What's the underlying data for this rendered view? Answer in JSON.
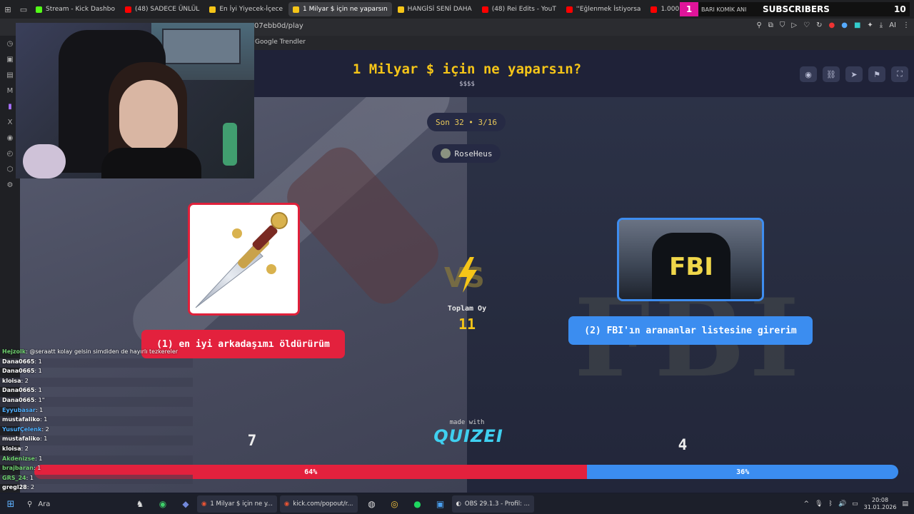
{
  "browser": {
    "tabs": [
      {
        "label": "Stream - Kick Dashbo",
        "color": "#53fc18"
      },
      {
        "label": "(48) SADECE ÜNLÜL",
        "color": "#ff0000"
      },
      {
        "label": "En İyi Yiyecek-İçece",
        "color": "#f5c518"
      },
      {
        "label": "1 Milyar $ için ne yaparsın",
        "color": "#f5c518",
        "active": true
      },
      {
        "label": "HANGİSİ SENİ DAHA",
        "color": "#f5c518"
      },
      {
        "label": "(48) Rei Edits - YouT",
        "color": "#ff0000"
      },
      {
        "label": "''Eğlenmek İstiyorsa",
        "color": "#ff0000"
      },
      {
        "label": "1.000.000TL ÖDÜLL",
        "color": "#ff0000"
      }
    ],
    "url": "07ebb0d/play",
    "bookmark": "Google Trendler",
    "subscribers_overlay": {
      "count_left": "1",
      "text": "BARI KOMİK ANI",
      "label": "SUBSCRIBERS",
      "count_right": "10"
    }
  },
  "game": {
    "title": "1 Milyar $ için ne yaparsın?",
    "subtitle": "$$$$",
    "round": "Son 32 • 3/16",
    "user": "RoseHeus",
    "option_left": "(1) en iyi arkadaşımı öldürürüm",
    "option_right": "(2) FBI'ın arananlar listesine girerim",
    "card_right_text": "FBI",
    "total_label": "Toplam Oy",
    "total_value": "11",
    "made_with": "made with",
    "logo": "QUIZEI",
    "count_left": "7",
    "count_right": "4",
    "percent_left": "64%",
    "percent_right": "36%",
    "fraction_left": 0.64
  },
  "chat": [
    {
      "name": "Hejzolk",
      "text": ": @seraatt kolay gelsin simdiden de hayırlı tezkereler",
      "color": "g"
    },
    {
      "name": "Dana0665",
      "text": ": 1"
    },
    {
      "name": "Dana0665",
      "text": ": 1"
    },
    {
      "name": "kloisa",
      "text": ": 2"
    },
    {
      "name": "Dana0665",
      "text": ": 1"
    },
    {
      "name": "Dana0665",
      "text": ": 1\""
    },
    {
      "name": "Eyyubasar",
      "text": ": 1",
      "color": "b"
    },
    {
      "name": "mustafaliko",
      "text": ": 1"
    },
    {
      "name": "YusufÇelenk",
      "text": ": 2",
      "color": "b"
    },
    {
      "name": "mustafaliko",
      "text": ": 1"
    },
    {
      "name": "kloisa",
      "text": ": 2"
    },
    {
      "name": "Akdenizse",
      "text": ": 1",
      "color": "g"
    },
    {
      "name": "brajbaran",
      "text": ": 1",
      "color": "g"
    },
    {
      "name": "GRS_24",
      "text": ": 1",
      "color": "g"
    },
    {
      "name": "gregl28",
      "text": ": 2"
    }
  ],
  "taskbar": {
    "search": "Ara",
    "apps": [
      {
        "label": "1 Milyar $ için ne y..."
      },
      {
        "label": "kick.com/popout/r..."
      },
      {
        "label": "OBS 29.1.3 - Profil: ..."
      }
    ],
    "time": "20:08",
    "date": "31.01.2026"
  }
}
